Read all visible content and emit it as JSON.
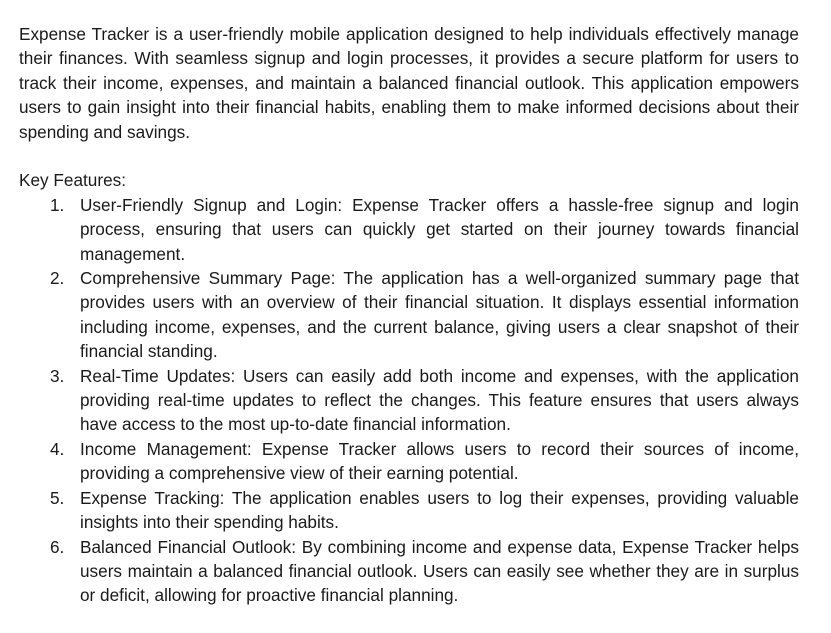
{
  "intro": "Expense Tracker is a user-friendly mobile application designed to help individuals effectively manage their finances. With seamless signup and login processes, it provides a secure platform for users to track their income, expenses, and maintain a balanced financial outlook. This application empowers users to gain insight into their financial habits, enabling them to make informed decisions about their spending and savings.",
  "features_heading": "Key Features:",
  "features": [
    {
      "num": "1.",
      "text": "User-Friendly Signup and Login: Expense Tracker offers a hassle-free signup and login process, ensuring that users can quickly get started on their journey towards financial management."
    },
    {
      "num": "2.",
      "text": "Comprehensive Summary Page: The application has a well-organized summary page that provides users with an overview of their financial situation. It displays essential information including income, expenses, and the current balance, giving users a clear snapshot of their financial standing."
    },
    {
      "num": "3.",
      "text": "Real-Time Updates: Users can easily add both income and expenses, with the application providing real-time updates to reflect the changes. This feature ensures that users always have access to the most up-to-date financial information."
    },
    {
      "num": "4.",
      "text": "Income Management: Expense Tracker allows users to record their sources of income, providing a comprehensive view of their earning potential."
    },
    {
      "num": "5.",
      "text": "Expense Tracking: The application enables users to log their expenses, providing valuable insights into their spending habits."
    },
    {
      "num": "6.",
      "text": "Balanced Financial Outlook: By combining income and expense data, Expense Tracker helps users maintain a balanced financial outlook. Users can easily see whether they are in surplus or deficit, allowing for proactive financial planning."
    }
  ]
}
